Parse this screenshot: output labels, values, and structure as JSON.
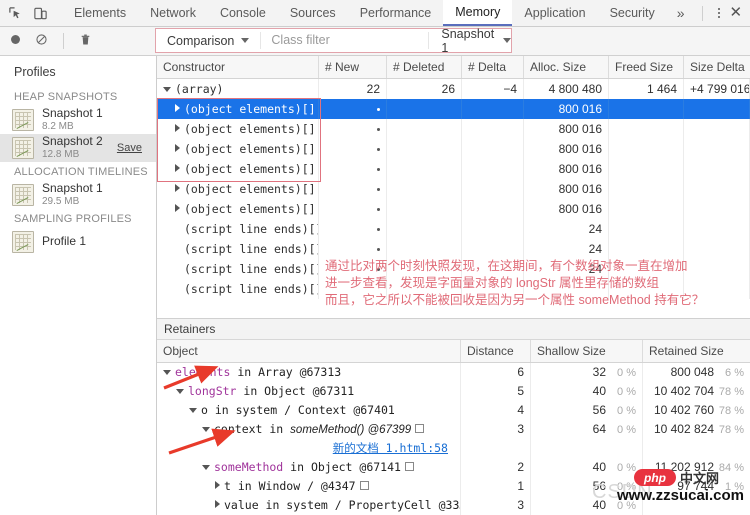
{
  "tabbar": {
    "icons": [
      "inspect-element-icon",
      "device-toolbar-icon"
    ],
    "tabs": [
      {
        "label": "Elements",
        "active": false
      },
      {
        "label": "Network",
        "active": false
      },
      {
        "label": "Console",
        "active": false
      },
      {
        "label": "Sources",
        "active": false
      },
      {
        "label": "Performance",
        "active": false
      },
      {
        "label": "Memory",
        "active": true
      },
      {
        "label": "Application",
        "active": false
      },
      {
        "label": "Security",
        "active": false
      }
    ],
    "more_label": "»",
    "close_label": "✕"
  },
  "toolbar": {
    "record_icon": "record-icon",
    "clear_icon": "clear-icon",
    "trash_icon": "trash-icon",
    "comparison_label": "Comparison",
    "class_filter_placeholder": "Class filter",
    "snapshot_select_label": "Snapshot 1"
  },
  "sidebar": {
    "title": "Profiles",
    "groups": [
      {
        "label": "HEAP SNAPSHOTS",
        "items": [
          {
            "name": "Snapshot 1",
            "size": "8.2 MB",
            "selected": false,
            "action": ""
          },
          {
            "name": "Snapshot 2",
            "size": "12.8 MB",
            "selected": true,
            "action": "Save"
          }
        ]
      },
      {
        "label": "ALLOCATION TIMELINES",
        "items": [
          {
            "name": "Snapshot 1",
            "size": "29.5 MB",
            "selected": false,
            "action": ""
          }
        ]
      },
      {
        "label": "SAMPLING PROFILES",
        "items": [
          {
            "name": "Profile 1",
            "size": "",
            "selected": false,
            "action": ""
          }
        ]
      }
    ]
  },
  "constructor_table": {
    "columns": [
      "Constructor",
      "# New",
      "# Deleted",
      "# Delta",
      "Alloc. Size",
      "Freed Size",
      "Size Delta"
    ],
    "rows": [
      {
        "name": "(array)",
        "toggle": "down",
        "indent": 0,
        "new": "22",
        "deleted": "26",
        "delta": "−4",
        "alloc": "4 800 480",
        "freed": "1 464",
        "sizedelta": "+4 799 016",
        "selected": false
      },
      {
        "name": "(object elements)[] @",
        "toggle": "right",
        "indent": 1,
        "new": "•",
        "deleted": "",
        "delta": "",
        "alloc": "800 016",
        "freed": "",
        "sizedelta": "",
        "selected": true
      },
      {
        "name": "(object elements)[] @",
        "toggle": "right",
        "indent": 1,
        "new": "•",
        "deleted": "",
        "delta": "",
        "alloc": "800 016",
        "freed": "",
        "sizedelta": "",
        "selected": false
      },
      {
        "name": "(object elements)[] @",
        "toggle": "right",
        "indent": 1,
        "new": "•",
        "deleted": "",
        "delta": "",
        "alloc": "800 016",
        "freed": "",
        "sizedelta": "",
        "selected": false
      },
      {
        "name": "(object elements)[] @",
        "toggle": "right",
        "indent": 1,
        "new": "•",
        "deleted": "",
        "delta": "",
        "alloc": "800 016",
        "freed": "",
        "sizedelta": "",
        "selected": false
      },
      {
        "name": "(object elements)[] @",
        "toggle": "right",
        "indent": 1,
        "new": "•",
        "deleted": "",
        "delta": "",
        "alloc": "800 016",
        "freed": "",
        "sizedelta": "",
        "selected": false
      },
      {
        "name": "(object elements)[] @",
        "toggle": "right",
        "indent": 1,
        "new": "•",
        "deleted": "",
        "delta": "",
        "alloc": "800 016",
        "freed": "",
        "sizedelta": "",
        "selected": false
      },
      {
        "name": "(script line ends)[]",
        "toggle": "none",
        "indent": 1,
        "new": "•",
        "deleted": "",
        "delta": "",
        "alloc": "24",
        "freed": "",
        "sizedelta": "",
        "selected": false
      },
      {
        "name": "(script line ends)[]",
        "toggle": "none",
        "indent": 1,
        "new": "•",
        "deleted": "",
        "delta": "",
        "alloc": "24",
        "freed": "",
        "sizedelta": "",
        "selected": false
      },
      {
        "name": "(script line ends)[]",
        "toggle": "none",
        "indent": 1,
        "new": "•",
        "deleted": "",
        "delta": "",
        "alloc": "24",
        "freed": "",
        "sizedelta": "",
        "selected": false
      },
      {
        "name": "(script line ends)[]",
        "toggle": "none",
        "indent": 1,
        "new": "",
        "deleted": "",
        "delta": "",
        "alloc": "",
        "freed": "",
        "sizedelta": "",
        "selected": false
      }
    ]
  },
  "retainers": {
    "title": "Retainers",
    "columns": [
      "Object",
      "Distance",
      "Shallow Size",
      "Retained Size"
    ],
    "rows": [
      {
        "prefix": "",
        "highlight": "elements",
        "rest": " in Array @67313",
        "toggle": "down",
        "indent": 0,
        "boxicon": false,
        "distance": "6",
        "shallow": "32",
        "shallow_pct": "0 %",
        "retained": "800 048",
        "retained_pct": "6 %"
      },
      {
        "prefix": "",
        "highlight": "longStr",
        "rest": " in Object @67311",
        "toggle": "down",
        "indent": 1,
        "boxicon": false,
        "distance": "5",
        "shallow": "40",
        "shallow_pct": "0 %",
        "retained": "10 402 704",
        "retained_pct": "78 %"
      },
      {
        "prefix": "",
        "highlight": "",
        "rest": "o in system / Context @67401",
        "toggle": "down",
        "indent": 2,
        "boxicon": false,
        "distance": "4",
        "shallow": "56",
        "shallow_pct": "0 %",
        "retained": "10 402 760",
        "retained_pct": "78 %"
      },
      {
        "prefix": "context in ",
        "highlight": "",
        "rest": "someMethod() @67399",
        "toggle": "down",
        "indent": 3,
        "boxicon": true,
        "italic_rest": true,
        "distance": "3",
        "shallow": "64",
        "shallow_pct": "0 %",
        "retained": "10 402 824",
        "retained_pct": "78 %"
      },
      {
        "prefix": "",
        "highlight": "someMethod",
        "rest": " in Object @67141",
        "toggle": "down",
        "indent": 3,
        "boxicon": true,
        "distance": "2",
        "shallow": "40",
        "shallow_pct": "0 %",
        "retained": "11 202 912",
        "retained_pct": "84 %"
      },
      {
        "prefix": "",
        "highlight": "",
        "rest": "t in Window /  @4347",
        "toggle": "right",
        "indent": 4,
        "boxicon": true,
        "distance": "1",
        "shallow": "56",
        "shallow_pct": "0 %",
        "retained": "97 744",
        "retained_pct": "1 %"
      },
      {
        "prefix": "",
        "highlight": "",
        "rest": "value in system / PropertyCell @33…",
        "toggle": "right",
        "indent": 4,
        "boxicon": false,
        "distance": "3",
        "shallow": "40",
        "shallow_pct": "0 %",
        "retained": "",
        "retained_pct": ""
      }
    ],
    "source_link": "新的文档 1.html:58"
  },
  "annotations": {
    "line1": "通过比对两个时刻快照发现，在这期间，有个数组对象一直在增加",
    "line2": "进一步查看，发现是字面量对象的 longStr 属性里存储的数组",
    "line3": "而且，它之所以不能被回收是因为另一个属性 someMethod 持有它？"
  },
  "watermark": {
    "csdn": "CSDN",
    "php_badge": "php",
    "php_cn": "中文网",
    "site": "www.zzsucai.com"
  },
  "colors": {
    "accent": "#5a6ebd",
    "selection": "#1a73e8",
    "annotation": "#e06b78",
    "link": "#1a6fd4",
    "highlight_text": "#a0349b"
  }
}
